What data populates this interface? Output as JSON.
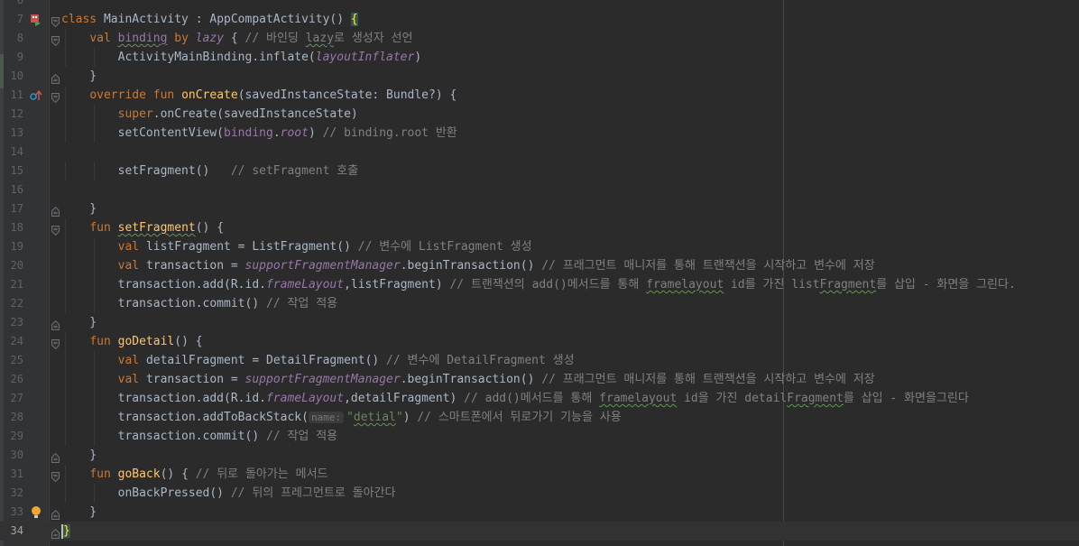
{
  "editor": {
    "language": "Kotlin",
    "caret_line": 34,
    "lines": [
      {
        "n": "6",
        "segs": []
      },
      {
        "n": "7",
        "icon": "class-run-icon",
        "fold": "open",
        "segs": [
          [
            "kw",
            "class "
          ],
          [
            "",
            "MainActivity : AppCompatActivity() "
          ],
          [
            "brace",
            "{"
          ]
        ]
      },
      {
        "n": "8",
        "fold": "open",
        "segs": [
          [
            "",
            "    "
          ],
          [
            "kw",
            "val "
          ],
          [
            "typo",
            "binding"
          ],
          [
            "kw",
            " by "
          ],
          [
            "ital",
            "lazy"
          ],
          [
            "",
            " { "
          ],
          [
            "cm",
            "// 바인딩 "
          ],
          [
            "cmtypo",
            "lazy"
          ],
          [
            "cm",
            "로 생성자 선언"
          ]
        ]
      },
      {
        "n": "9",
        "segs": [
          [
            "",
            "        ActivityMainBinding.inflate("
          ],
          [
            "ital",
            "layoutInflater"
          ],
          [
            "",
            ")"
          ]
        ]
      },
      {
        "n": "10",
        "fold": "close",
        "segs": [
          [
            "",
            "    }"
          ]
        ]
      },
      {
        "n": "11",
        "icon": "override-icon",
        "fold": "open",
        "segs": [
          [
            "",
            "    "
          ],
          [
            "kw",
            "override fun "
          ],
          [
            "fn",
            "onCreate"
          ],
          [
            "",
            "(savedInstanceState: Bundle?) {"
          ]
        ]
      },
      {
        "n": "12",
        "segs": [
          [
            "",
            "        "
          ],
          [
            "kw",
            "super"
          ],
          [
            "",
            ".onCreate(savedInstanceState)"
          ]
        ]
      },
      {
        "n": "13",
        "segs": [
          [
            "",
            "        setContentView("
          ],
          [
            "ital2",
            "binding"
          ],
          [
            "",
            "."
          ],
          [
            "ital",
            "root"
          ],
          [
            "",
            ") "
          ],
          [
            "cm",
            "// binding.root 반환"
          ]
        ]
      },
      {
        "n": "14",
        "segs": []
      },
      {
        "n": "15",
        "segs": [
          [
            "",
            "        setFragment()   "
          ],
          [
            "cm",
            "// setFragment 호출"
          ]
        ]
      },
      {
        "n": "16",
        "segs": []
      },
      {
        "n": "17",
        "fold": "close",
        "segs": [
          [
            "",
            "    }"
          ]
        ]
      },
      {
        "n": "18",
        "fold": "open",
        "segs": [
          [
            "",
            "    "
          ],
          [
            "kw",
            "fun "
          ],
          [
            "fntypo",
            "setFragment"
          ],
          [
            "",
            "() {"
          ]
        ]
      },
      {
        "n": "19",
        "segs": [
          [
            "",
            "        "
          ],
          [
            "kw",
            "val "
          ],
          [
            "",
            "listFragment = ListFragment() "
          ],
          [
            "cm",
            "// 변수에 ListFragment 생성"
          ]
        ]
      },
      {
        "n": "20",
        "segs": [
          [
            "",
            "        "
          ],
          [
            "kw",
            "val "
          ],
          [
            "",
            "transaction = "
          ],
          [
            "ital",
            "supportFragmentManager"
          ],
          [
            "",
            ".beginTransaction() "
          ],
          [
            "cm",
            "// 프래그먼트 매니저를 통해 트랜잭션을 시작하고 변수에 저장"
          ]
        ]
      },
      {
        "n": "21",
        "segs": [
          [
            "",
            "        transaction.add(R.id."
          ],
          [
            "ital",
            "frameLayout"
          ],
          [
            "",
            ",listFragment) "
          ],
          [
            "cm",
            "// 트랜잭션의 add()메서드를 통해 "
          ],
          [
            "cmtypo",
            "framelayout"
          ],
          [
            "cm",
            " id를 가진 list"
          ],
          [
            "cmtypo",
            "Fragment"
          ],
          [
            "cm",
            "를 삽입 - 화면을 그린다."
          ]
        ]
      },
      {
        "n": "22",
        "segs": [
          [
            "",
            "        transaction.commit() "
          ],
          [
            "cm",
            "// 작업 적용"
          ]
        ]
      },
      {
        "n": "23",
        "fold": "close",
        "segs": [
          [
            "",
            "    }"
          ]
        ]
      },
      {
        "n": "24",
        "fold": "open",
        "segs": [
          [
            "",
            "    "
          ],
          [
            "kw",
            "fun "
          ],
          [
            "fn",
            "goDetail"
          ],
          [
            "",
            "() {"
          ]
        ]
      },
      {
        "n": "25",
        "segs": [
          [
            "",
            "        "
          ],
          [
            "kw",
            "val "
          ],
          [
            "",
            "detailFragment = DetailFragment() "
          ],
          [
            "cm",
            "// 변수에 DetailFragment 생성"
          ]
        ]
      },
      {
        "n": "26",
        "segs": [
          [
            "",
            "        "
          ],
          [
            "kw",
            "val "
          ],
          [
            "",
            "transaction = "
          ],
          [
            "ital",
            "supportFragmentManager"
          ],
          [
            "",
            ".beginTransaction() "
          ],
          [
            "cm",
            "// 프래그먼트 매니저를 통해 트랜잭션을 시작하고 변수에 저장"
          ]
        ]
      },
      {
        "n": "27",
        "segs": [
          [
            "",
            "        transaction.add(R.id."
          ],
          [
            "ital",
            "frameLayout"
          ],
          [
            "",
            ",detailFragment) "
          ],
          [
            "cm",
            "// add()메서드를 통해 "
          ],
          [
            "cmtypo",
            "framelayout"
          ],
          [
            "cm",
            " id을 가진 detail"
          ],
          [
            "cmtypo",
            "Fragment"
          ],
          [
            "cm",
            "를 삽입 - 화면을그린다"
          ]
        ]
      },
      {
        "n": "28",
        "segs": [
          [
            "",
            "        transaction.addToBackStack("
          ],
          [
            "hint",
            "name:"
          ],
          [
            "str",
            "\""
          ],
          [
            "strtypo",
            "detial"
          ],
          [
            "str",
            "\""
          ],
          [
            "",
            ") "
          ],
          [
            "cm",
            "// 스마트폰에서 뒤로가기 기능을 사용"
          ]
        ]
      },
      {
        "n": "29",
        "segs": [
          [
            "",
            "        transaction.commit() "
          ],
          [
            "cm",
            "// 작업 적용"
          ]
        ]
      },
      {
        "n": "30",
        "fold": "close",
        "segs": [
          [
            "",
            "    }"
          ]
        ]
      },
      {
        "n": "31",
        "fold": "open",
        "segs": [
          [
            "",
            "    "
          ],
          [
            "kw",
            "fun "
          ],
          [
            "fn",
            "goBack"
          ],
          [
            "",
            "() { "
          ],
          [
            "cm",
            "// 뒤로 돌아가는 메서드"
          ]
        ]
      },
      {
        "n": "32",
        "segs": [
          [
            "",
            "        onBackPressed() "
          ],
          [
            "cm",
            "// 뒤의 프레그먼트로 돌아간다"
          ]
        ]
      },
      {
        "n": "33",
        "icon": "bulb-icon",
        "fold": "close",
        "segs": [
          [
            "",
            "    }"
          ]
        ]
      },
      {
        "n": "34",
        "fold": "close",
        "current": true,
        "segs": [
          [
            "bracecaret",
            "}"
          ]
        ]
      }
    ]
  },
  "colors": {
    "background": "#2b2b2b",
    "gutter": "#313335",
    "keyword": "#cc7832",
    "function": "#ffc66d",
    "comment": "#808080",
    "property": "#9876aa",
    "string": "#6a8759",
    "text": "#a9b7c6"
  }
}
